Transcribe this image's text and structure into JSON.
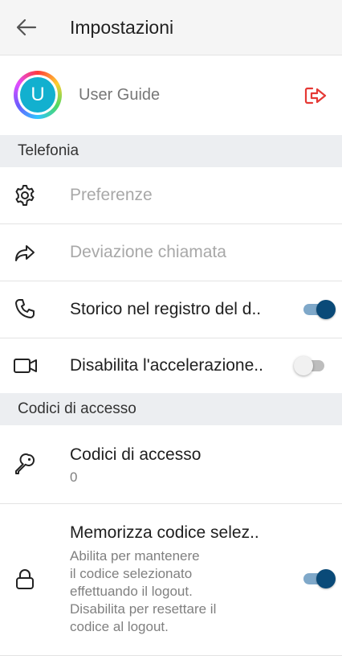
{
  "header": {
    "title": "Impostazioni",
    "back_icon": "arrow-left-icon"
  },
  "profile": {
    "avatar_letter": "U",
    "name": "User Guide",
    "logout_icon": "logout-icon",
    "logout_color": "#e53935"
  },
  "sections": {
    "telefonia": "Telefonia",
    "codici": "Codici di accesso"
  },
  "telefonia_rows": {
    "preferenze": {
      "label": "Preferenze",
      "icon": "gear-icon",
      "enabled": false
    },
    "deviazione": {
      "label": "Deviazione chiamata",
      "icon": "forward-icon",
      "enabled": false
    },
    "storico": {
      "label": "Storico nel registro del d..",
      "icon": "phone-icon",
      "toggle": true
    },
    "accelerazione": {
      "label": "Disabilita l'accelerazione..",
      "icon": "video-camera-icon",
      "toggle": false
    }
  },
  "codici_rows": {
    "codici": {
      "label": "Codici di accesso",
      "value": "0",
      "icon": "key-icon"
    },
    "memorizza": {
      "label": "Memorizza codice selez..",
      "description_lines": [
        "Abilita per mantenere",
        "il codice selezionato",
        "effettuando il logout.",
        "Disabilita per resettare il",
        "codice al logout."
      ],
      "icon": "lock-icon",
      "toggle": true
    }
  },
  "colors": {
    "accent": "#0a4a78",
    "section_bg": "#eceef1",
    "appbar_bg": "#f5f5f5"
  }
}
